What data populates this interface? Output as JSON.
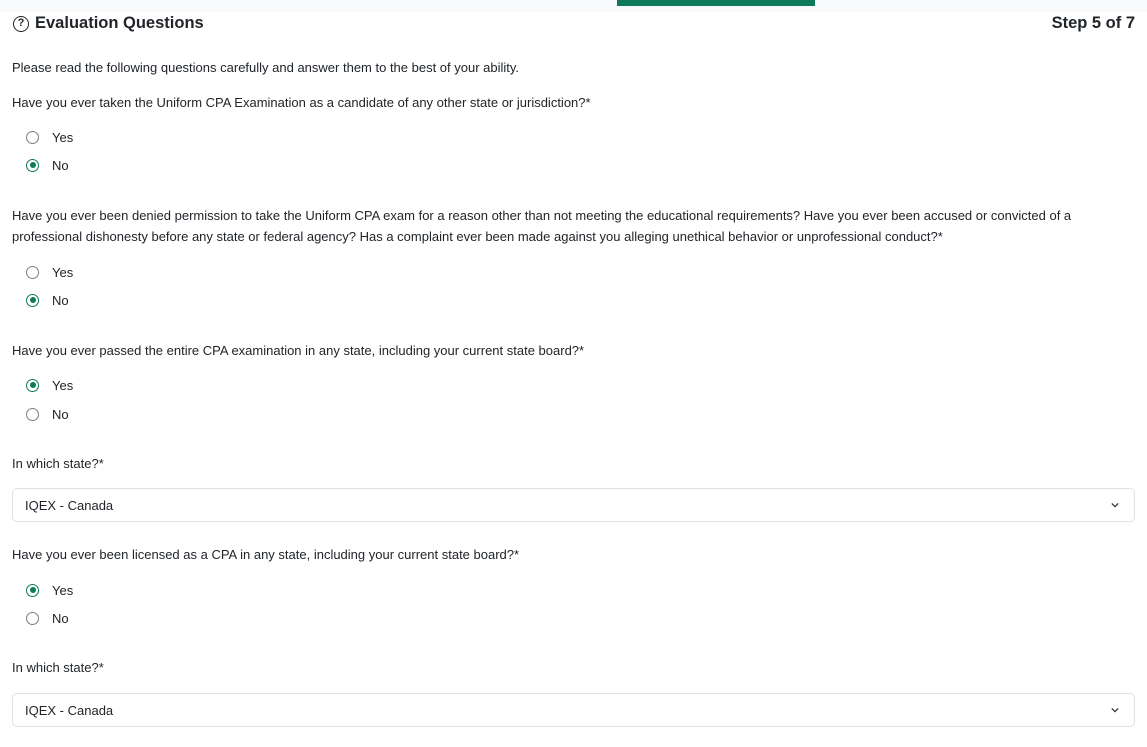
{
  "header": {
    "title": "Evaluation Questions",
    "help_icon": "?",
    "step": "Step 5 of 7"
  },
  "intro": "Please read the following questions carefully and answer them to the best of your ability.",
  "questions": [
    {
      "text": "Have you ever taken the Uniform CPA Examination as a candidate of any other state or jurisdiction?*",
      "options": [
        "Yes",
        "No"
      ],
      "selected": "No"
    },
    {
      "text": "Have you ever been denied permission to take the Uniform CPA exam for a reason other than not meeting the educational requirements? Have you ever been accused or convicted of a professional dishonesty before any state or federal agency? Has a complaint ever been made against you alleging unethical behavior or unprofessional conduct?*",
      "options": [
        "Yes",
        "No"
      ],
      "selected": "No"
    },
    {
      "text": "Have you ever passed the entire CPA examination in any state, including your current state board?*",
      "options": [
        "Yes",
        "No"
      ],
      "selected": "Yes",
      "followup_label": "In which state?*",
      "followup_value": "IQEX - Canada"
    },
    {
      "text": "Have you ever been licensed as a CPA in any state, including your current state board?*",
      "options": [
        "Yes",
        "No"
      ],
      "selected": "Yes",
      "followup_label": "In which state?*",
      "followup_value": "IQEX - Canada"
    }
  ],
  "colors": {
    "accent": "#0f7a57",
    "text": "#212529",
    "border": "#dee2e6"
  },
  "icons": {
    "help": "question-circle-icon",
    "select_arrow": "chevron-down-icon"
  }
}
